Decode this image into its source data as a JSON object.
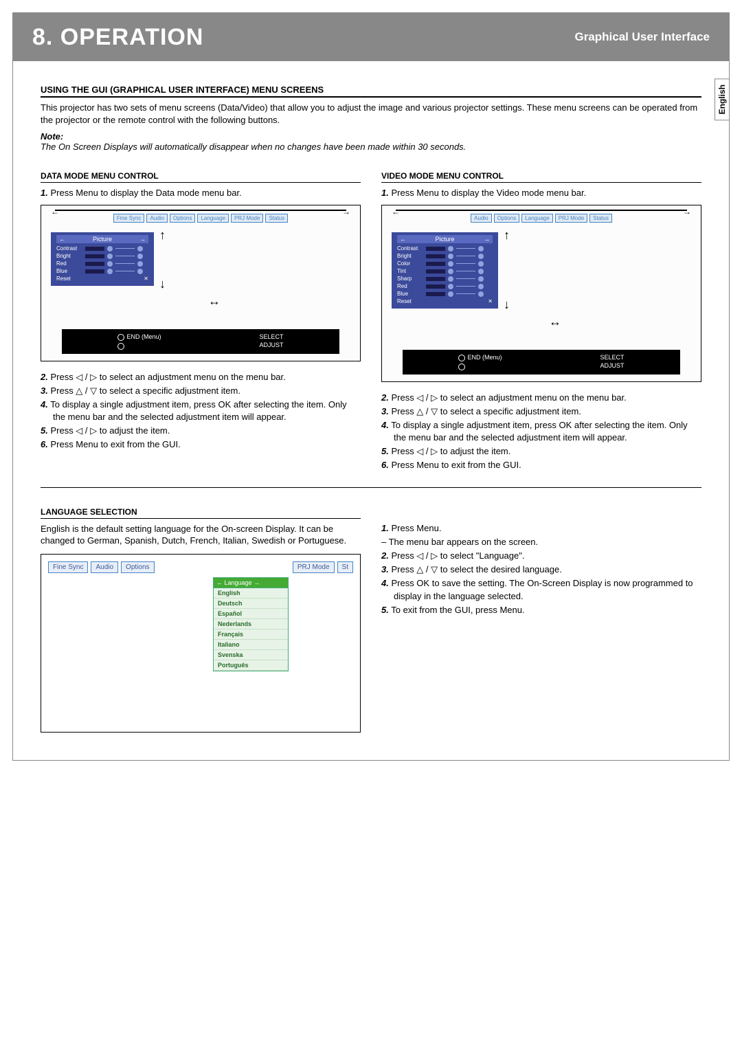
{
  "header": {
    "chapter": "8. OPERATION",
    "subtitle": "Graphical User Interface"
  },
  "langTab": "English",
  "intro": {
    "heading": "USING THE GUI (GRAPHICAL USER INTERFACE) MENU SCREENS",
    "text": "This projector has two sets of menu screens (Data/Video) that allow you to adjust the image and various projector settings. These menu screens can be operated from the projector or the remote control with the following buttons.",
    "noteLabel": "Note:",
    "noteText": "The On Screen Displays will automatically disappear when no changes have been made within 30 seconds."
  },
  "dataMode": {
    "heading": "DATA MODE MENU CONTROL",
    "step1": "Press Menu to display the Data mode menu bar.",
    "tabs": [
      "Fine Sync",
      "Audio",
      "Options",
      "Language",
      "PRJ Mode",
      "Status"
    ],
    "panelTitle": "Picture",
    "items": [
      "Contrast",
      "Bright",
      "Red",
      "Blue",
      "Reset"
    ],
    "footer": {
      "l1": "END (Menu)",
      "l2": "",
      "r1": "SELECT",
      "r2": "ADJUST"
    },
    "step2": "Press ◁ / ▷ to select an adjustment menu on the menu bar.",
    "step3": "Press △ / ▽ to select a specific adjustment item.",
    "step4": "To display a single adjustment item, press OK after selecting the item. Only the menu bar and the selected adjustment item will appear.",
    "step5": "Press ◁ / ▷ to adjust the item.",
    "step6": "Press Menu to exit from the GUI."
  },
  "videoMode": {
    "heading": "VIDEO MODE MENU CONTROL",
    "step1": "Press Menu to display the Video mode menu bar.",
    "tabs": [
      "Audio",
      "Options",
      "Language",
      "PRJ Mode",
      "Status"
    ],
    "panelTitle": "Picture",
    "items": [
      "Contrast",
      "Bright",
      "Color",
      "Tint",
      "Sharp",
      "Red",
      "Blue",
      "Reset"
    ],
    "footer": {
      "l1": "END (Menu)",
      "l2": "",
      "r1": "SELECT",
      "r2": "ADJUST"
    },
    "step2": "Press ◁ / ▷ to select an adjustment menu on the menu bar.",
    "step3": "Press △ / ▽ to select a specific adjustment item.",
    "step4": "To display a single adjustment item, press OK after selecting the item. Only the menu bar and the selected adjustment item will appear.",
    "step5": "Press ◁ / ▷ to adjust the item.",
    "step6": "Press Menu to exit from the GUI."
  },
  "language": {
    "heading": "LANGUAGE SELECTION",
    "text": "English is the default setting language for the On-screen Display. It can be changed to German, Spanish, Dutch, French, Italian, Swedish or Portuguese.",
    "tabs": [
      "Fine Sync",
      "Audio",
      "Options",
      "PRJ Mode",
      "St"
    ],
    "ddHeader": "Language",
    "options": [
      "English",
      "Deutsch",
      "Español",
      "Nederlands",
      "Français",
      "Italiano",
      "Svenska",
      "Português"
    ],
    "step1": "Press Menu.",
    "step1a": "The menu bar appears on the screen.",
    "step2": "Press ◁ / ▷ to select \"Language\".",
    "step3": "Press △ / ▽ to select the desired language.",
    "step4": "Press OK to save the setting. The On-Screen Display is now programmed to display in the language selected.",
    "step5": "To exit from the GUI, press Menu."
  }
}
